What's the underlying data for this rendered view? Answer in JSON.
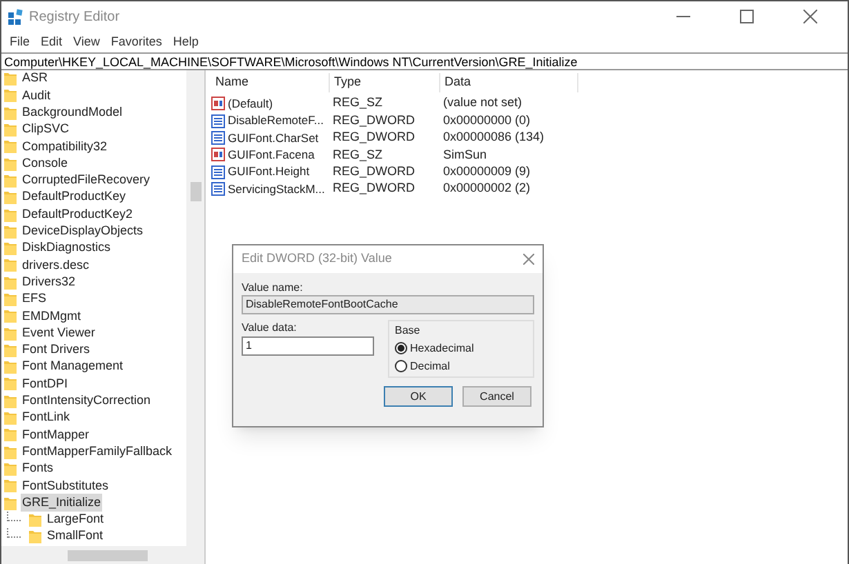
{
  "window": {
    "title": "Registry Editor"
  },
  "menu": [
    "File",
    "Edit",
    "View",
    "Favorites",
    "Help"
  ],
  "address": "Computer\\HKEY_LOCAL_MACHINE\\SOFTWARE\\Microsoft\\Windows NT\\CurrentVersion\\GRE_Initialize",
  "tree": [
    {
      "label": "ASR",
      "selected": false
    },
    {
      "label": "Audit",
      "selected": false
    },
    {
      "label": "BackgroundModel",
      "selected": false
    },
    {
      "label": "ClipSVC",
      "selected": false
    },
    {
      "label": "Compatibility32",
      "selected": false
    },
    {
      "label": "Console",
      "selected": false
    },
    {
      "label": "CorruptedFileRecovery",
      "selected": false
    },
    {
      "label": "DefaultProductKey",
      "selected": false
    },
    {
      "label": "DefaultProductKey2",
      "selected": false
    },
    {
      "label": "DeviceDisplayObjects",
      "selected": false
    },
    {
      "label": "DiskDiagnostics",
      "selected": false
    },
    {
      "label": "drivers.desc",
      "selected": false
    },
    {
      "label": "Drivers32",
      "selected": false
    },
    {
      "label": "EFS",
      "selected": false
    },
    {
      "label": "EMDMgmt",
      "selected": false
    },
    {
      "label": "Event Viewer",
      "selected": false
    },
    {
      "label": "Font Drivers",
      "selected": false
    },
    {
      "label": "Font Management",
      "selected": false
    },
    {
      "label": "FontDPI",
      "selected": false
    },
    {
      "label": "FontIntensityCorrection",
      "selected": false
    },
    {
      "label": "FontLink",
      "selected": false
    },
    {
      "label": "FontMapper",
      "selected": false
    },
    {
      "label": "FontMapperFamilyFallback",
      "selected": false
    },
    {
      "label": "Fonts",
      "selected": false
    },
    {
      "label": "FontSubstitutes",
      "selected": false
    },
    {
      "label": "GRE_Initialize",
      "selected": true,
      "children": [
        {
          "label": "LargeFont",
          "selected": false
        },
        {
          "label": "SmallFont",
          "selected": false
        }
      ]
    }
  ],
  "table": {
    "columns": [
      "Name",
      "Type",
      "Data"
    ],
    "rows": [
      {
        "kind": "string",
        "name": "(Default)",
        "type": "REG_SZ",
        "data": "(value not set)"
      },
      {
        "kind": "binary",
        "name": "DisableRemoteF...",
        "type": "REG_DWORD",
        "data": "0x00000000 (0)"
      },
      {
        "kind": "binary",
        "name": "GUIFont.CharSet",
        "type": "REG_DWORD",
        "data": "0x00000086 (134)"
      },
      {
        "kind": "string",
        "name": "GUIFont.Facena",
        "type": "REG_SZ",
        "data": "SimSun"
      },
      {
        "kind": "binary",
        "name": "GUIFont.Height",
        "type": "REG_DWORD",
        "data": "0x00000009 (9)"
      },
      {
        "kind": "binary",
        "name": "ServicingStackM...",
        "type": "REG_DWORD",
        "data": "0x00000002 (2)"
      }
    ]
  },
  "dialog": {
    "title": "Edit DWORD (32-bit) Value",
    "value_name_label": "Value name:",
    "value_name": "DisableRemoteFontBootCache",
    "value_data_label": "Value data:",
    "value_data": "1",
    "base_label": "Base",
    "bases": [
      {
        "label": "Hexadecimal",
        "selected": true
      },
      {
        "label": "Decimal",
        "selected": false
      }
    ],
    "buttons": [
      "OK",
      "Cancel"
    ]
  }
}
